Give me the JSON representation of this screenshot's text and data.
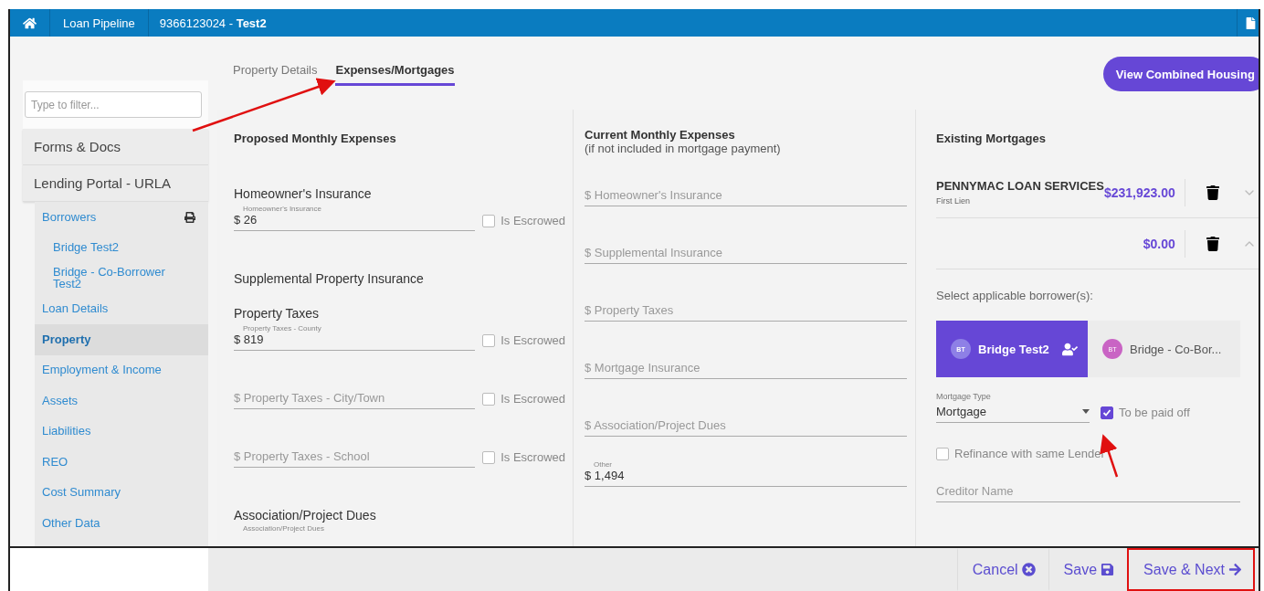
{
  "topbar": {
    "pipeline": "Loan Pipeline",
    "loan": "9366123024 - **Test2**"
  },
  "sidebar": {
    "filter_placeholder": "Type to filter...",
    "sections": [
      {
        "label": "Forms & Docs"
      },
      {
        "label": "Lending Portal - URLA"
      }
    ],
    "items": [
      {
        "label": "Borrowers",
        "selected": false,
        "printable": true,
        "children": [
          {
            "label": "Bridge Test2"
          },
          {
            "label": "Bridge - Co-Borrower Test2"
          }
        ]
      },
      {
        "label": "Loan Details",
        "selected": false
      },
      {
        "label": "Property",
        "selected": true
      },
      {
        "label": "Employment & Income",
        "selected": false
      },
      {
        "label": "Assets",
        "selected": false
      },
      {
        "label": "Liabilities",
        "selected": false
      },
      {
        "label": "REO",
        "selected": false
      },
      {
        "label": "Cost Summary",
        "selected": false
      },
      {
        "label": "Other Data",
        "selected": false
      }
    ]
  },
  "tabs": [
    {
      "label": "Property Details",
      "selected": false
    },
    {
      "label": "Expenses/Mortgages",
      "selected": true
    }
  ],
  "combined_button": "View Combined Housing",
  "proposed": {
    "title": "Proposed Monthly Expenses",
    "rows": [
      {
        "kind": "heading",
        "label": "Homeowner's Insurance"
      },
      {
        "kind": "field",
        "label": "Homeowner's Insurance",
        "prefix": "$",
        "value": "26",
        "escrow_label": "Is Escrowed",
        "escrowed": false
      },
      {
        "kind": "heading",
        "label": "Supplemental Property Insurance"
      },
      {
        "kind": "heading",
        "label": "Property Taxes"
      },
      {
        "kind": "field",
        "label": "Property Taxes - County",
        "prefix": "$",
        "value": "819",
        "escrow_label": "Is Escrowed",
        "escrowed": false
      },
      {
        "kind": "field",
        "prefix": "$",
        "placeholder": "Property Taxes - City/Town",
        "escrow_label": "Is Escrowed",
        "escrowed": false
      },
      {
        "kind": "field",
        "prefix": "$",
        "placeholder": "Property Taxes - School",
        "escrow_label": "Is Escrowed",
        "escrowed": false
      },
      {
        "kind": "heading",
        "label": "Association/Project Dues"
      },
      {
        "kind": "caption",
        "label": "Association/Project Dues"
      }
    ]
  },
  "current": {
    "title": "Current Monthly Expenses",
    "subtitle": "(if not included in mortgage payment)",
    "fields": [
      {
        "prefix": "$",
        "placeholder": "Homeowner's Insurance"
      },
      {
        "prefix": "$",
        "placeholder": "Supplemental Insurance"
      },
      {
        "prefix": "$",
        "placeholder": "Property Taxes"
      },
      {
        "prefix": "$",
        "placeholder": "Mortgage Insurance"
      },
      {
        "prefix": "$",
        "placeholder": "Association/Project Dues"
      },
      {
        "prefix": "$",
        "label": "Other",
        "value": "1,494"
      }
    ]
  },
  "mortgages": {
    "title": "Existing Mortgages",
    "items": [
      {
        "creditor": "PENNYMAC LOAN SERVICES",
        "lien": "First Lien",
        "amount": "$231,923.00",
        "expanded": false
      },
      {
        "amount": "$0.00",
        "expanded": true
      }
    ],
    "borrower_prompt": "Select applicable borrower(s):",
    "borrowers": [
      {
        "initials": "BT",
        "name": "Bridge Test2",
        "selected": true,
        "color": "#8e80e6"
      },
      {
        "initials": "BT",
        "name": "Bridge - Co-Bor...",
        "selected": false,
        "color": "#c964c4"
      }
    ],
    "mortgage_type": {
      "label": "Mortgage Type",
      "value": "Mortgage"
    },
    "paid_off": {
      "label": "To be paid off",
      "checked": true
    },
    "refinance": {
      "label": "Refinance with same Lender",
      "checked": false
    },
    "creditor": {
      "placeholder": "Creditor Name"
    }
  },
  "footer": {
    "buttons": [
      {
        "kind": "cancel",
        "label": "Cancel",
        "highlighted": false
      },
      {
        "kind": "save",
        "label": "Save",
        "highlighted": false
      },
      {
        "kind": "next",
        "label": "Save & Next",
        "highlighted": true
      }
    ]
  }
}
